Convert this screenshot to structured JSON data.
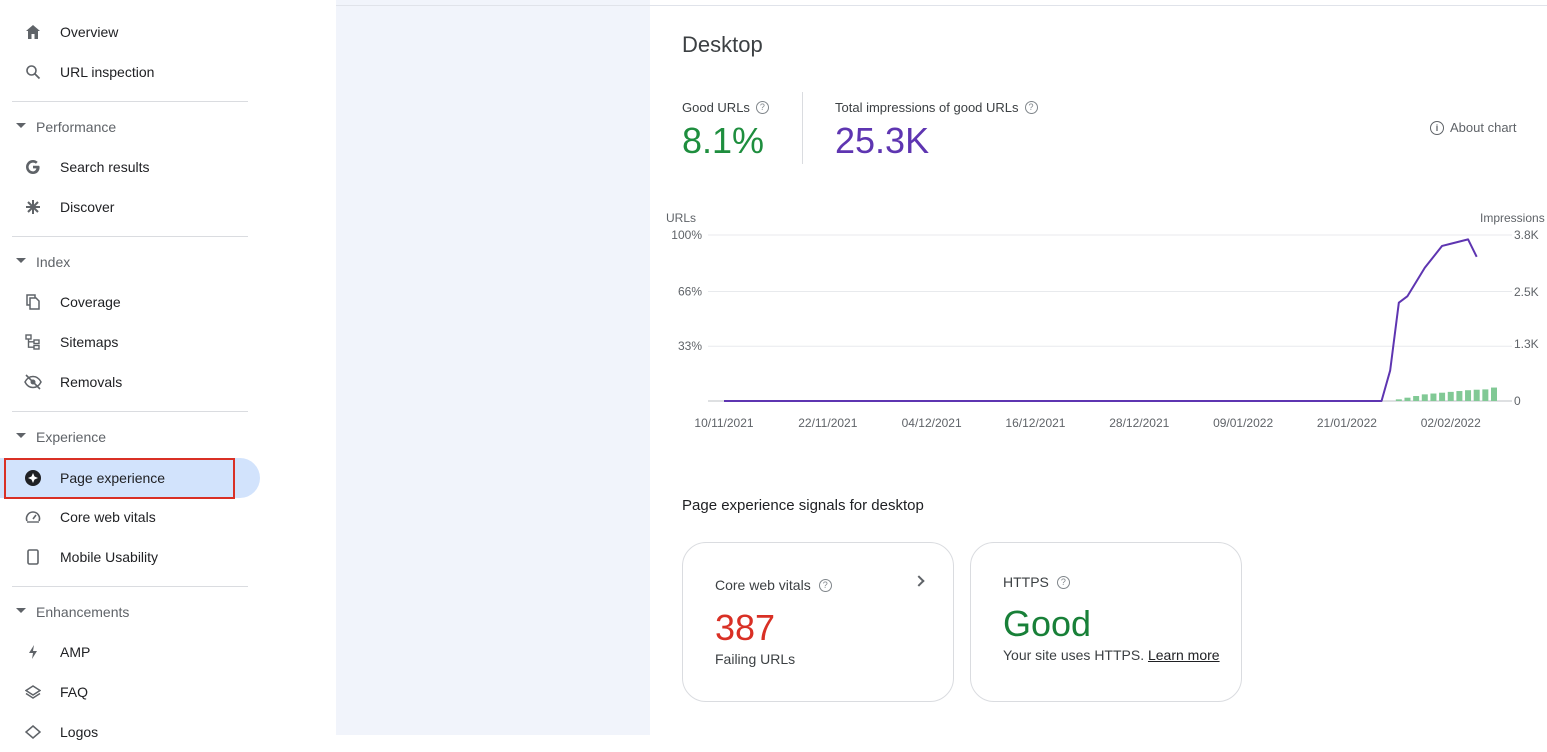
{
  "sidebar": {
    "items": [
      {
        "label": "Overview",
        "icon": "home-icon"
      },
      {
        "label": "URL inspection",
        "icon": "search-icon"
      },
      {
        "label": "Search results",
        "icon": "google-g-icon"
      },
      {
        "label": "Discover",
        "icon": "asterisk-icon"
      },
      {
        "label": "Coverage",
        "icon": "pages-icon"
      },
      {
        "label": "Sitemaps",
        "icon": "sitemap-icon"
      },
      {
        "label": "Removals",
        "icon": "eye-off-icon"
      },
      {
        "label": "Page experience",
        "icon": "compass-icon"
      },
      {
        "label": "Core web vitals",
        "icon": "gauge-icon"
      },
      {
        "label": "Mobile Usability",
        "icon": "phone-icon"
      },
      {
        "label": "AMP",
        "icon": "bolt-icon"
      },
      {
        "label": "FAQ",
        "icon": "layers-icon"
      },
      {
        "label": "Logos",
        "icon": "diamond-icon"
      }
    ],
    "sections": [
      "Performance",
      "Index",
      "Experience",
      "Enhancements"
    ],
    "active_item": "Page experience"
  },
  "main": {
    "title": "Desktop",
    "metrics": [
      {
        "label": "Good URLs",
        "value": "8.1%",
        "color": "#1e8e3e"
      },
      {
        "label": "Total impressions of good URLs",
        "value": "25.3K",
        "color": "#5e35b1"
      }
    ],
    "about_chart": "About chart",
    "signals_title": "Page experience signals for desktop",
    "cards": [
      {
        "label": "Core web vitals",
        "value": "387",
        "sub": "Failing URLs",
        "color": "#d93025"
      },
      {
        "label": "HTTPS",
        "value": "Good",
        "sub": "Your site uses HTTPS.",
        "link": "Learn more",
        "color": "#188038"
      }
    ]
  },
  "chart_data": {
    "type": "bar",
    "left_axis_label": "URLs",
    "right_axis_label": "Impressions",
    "left_ticks": [
      "100%",
      "66%",
      "33%"
    ],
    "right_ticks": [
      "3.8K",
      "2.5K",
      "1.3K",
      "0"
    ],
    "ylim_left": [
      0,
      100
    ],
    "ylim_right": [
      0,
      3800
    ],
    "x_tick_labels": [
      "10/11/2021",
      "22/11/2021",
      "04/12/2021",
      "16/12/2021",
      "28/12/2021",
      "09/01/2022",
      "21/01/2022",
      "02/02/2022"
    ],
    "x_range": [
      "10/11/2021",
      "07/02/2022"
    ],
    "series": [
      {
        "name": "Good URLs",
        "kind": "bar",
        "axis": "left",
        "color": "#81c995",
        "x": [
          "27/01/2022",
          "28/01/2022",
          "29/01/2022",
          "30/01/2022",
          "31/01/2022",
          "01/02/2022",
          "02/02/2022",
          "03/02/2022",
          "04/02/2022",
          "05/02/2022",
          "06/02/2022",
          "07/02/2022"
        ],
        "values": [
          1,
          2,
          3,
          4,
          4.5,
          5,
          5.5,
          6,
          6.5,
          6.8,
          7,
          8.1
        ]
      },
      {
        "name": "Total impressions of good URLs",
        "kind": "line",
        "axis": "right",
        "color": "#5e35b1",
        "x": [
          "10/11/2021",
          "25/01/2022",
          "26/01/2022",
          "27/01/2022",
          "28/01/2022",
          "30/01/2022",
          "01/02/2022",
          "02/02/2022",
          "04/02/2022",
          "05/02/2022"
        ],
        "values": [
          0,
          0,
          700,
          2250,
          2400,
          3050,
          3550,
          3600,
          3700,
          3300
        ]
      }
    ]
  }
}
